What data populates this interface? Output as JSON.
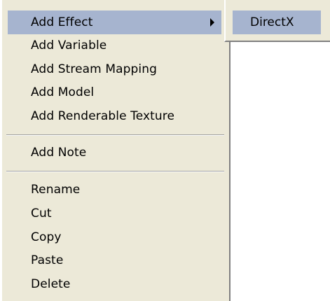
{
  "context_menu": {
    "items": [
      {
        "label": "Add Effect",
        "has_submenu": true,
        "highlighted": true
      },
      {
        "label": "Add Variable"
      },
      {
        "label": "Add Stream Mapping"
      },
      {
        "label": "Add Model"
      },
      {
        "label": "Add Renderable Texture"
      },
      {
        "label": "Add Note"
      },
      {
        "label": "Rename"
      },
      {
        "label": "Cut"
      },
      {
        "label": "Copy"
      },
      {
        "label": "Paste"
      },
      {
        "label": "Delete"
      }
    ]
  },
  "submenu": {
    "items": [
      {
        "label": "DirectX",
        "highlighted": true
      }
    ]
  },
  "colors": {
    "menu_background": "#ece9d8",
    "highlight": "#a6b4cf",
    "separator": "#a0a0a0"
  }
}
